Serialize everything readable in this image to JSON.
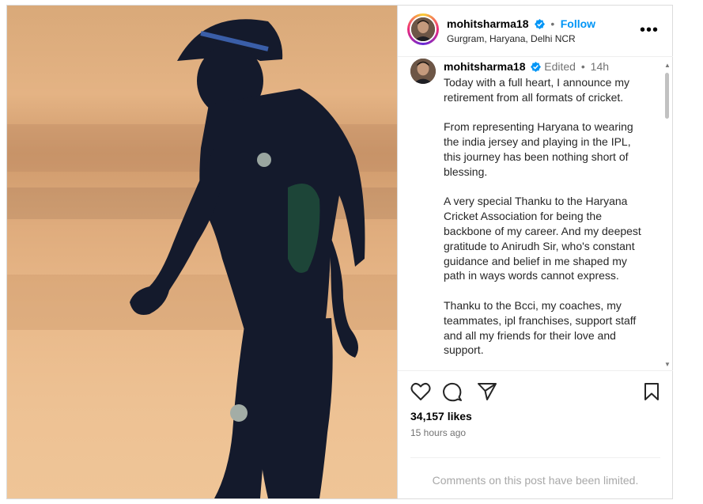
{
  "post": {
    "username": "mohitsharma18",
    "follow_label": "Follow",
    "dot": "•",
    "location": "Gurgram, Haryana, Delhi NCR",
    "more_label": "•••",
    "edited_label": "Edited",
    "time_short": "14h",
    "caption_paragraphs": [
      "Today with a full heart, I announce my retirement from all formats of cricket.",
      "From representing Haryana to wearing the india jersey and playing in the IPL, this journey has been nothing short of blessing.",
      "A very special Thanku to the Haryana Cricket Association for being the backbone of my career. And my deepest gratitude to Anirudh Sir, who's constant guidance and belief in me shaped my path in ways words cannot express.",
      "Thanku to the Bcci, my coaches, my teammates, ipl franchises, support staff and all my friends for their love and support."
    ],
    "likes": "34,157 likes",
    "time_ago": "15 hours ago",
    "comments_limited": "Comments on this post have been limited."
  },
  "icons": {
    "like": "heart-icon",
    "comment": "comment-icon",
    "share": "share-icon",
    "save": "bookmark-icon",
    "verified": "verified-badge-icon"
  },
  "colors": {
    "accent": "#0095f6",
    "muted": "#737373",
    "limited": "#a8a8a8"
  }
}
